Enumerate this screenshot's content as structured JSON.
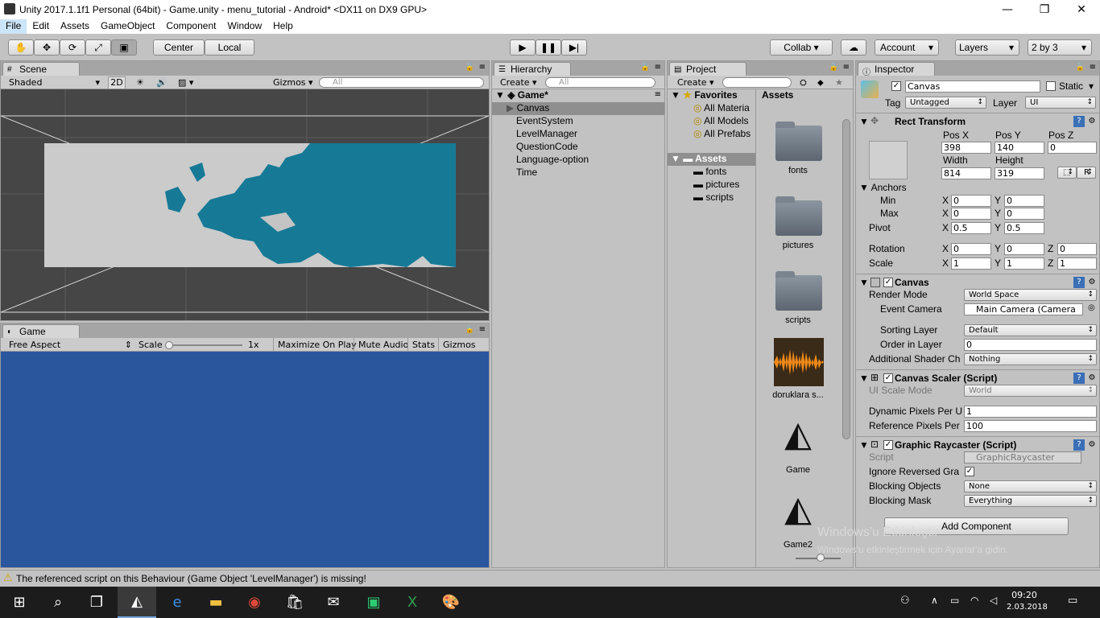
{
  "window": {
    "title": "Unity 2017.1.1f1 Personal (64bit) - Game.unity - menu_tutorial - Android* <DX11 on DX9 GPU>",
    "minimize": "—",
    "maximize": "❐",
    "close": "✕"
  },
  "menu": [
    "File",
    "Edit",
    "Assets",
    "GameObject",
    "Component",
    "Window",
    "Help"
  ],
  "toolbar": {
    "center": "Center",
    "local": "Local",
    "collab": "Collab ▾",
    "account": "Account",
    "layers": "Layers",
    "layout": "2 by 3"
  },
  "scene": {
    "tab": "Scene",
    "shading": "Shaded",
    "mode2d": "2D",
    "gizmos": "Gizmos ▾",
    "search": "All"
  },
  "game": {
    "tab": "Game",
    "aspect": "Free Aspect",
    "scale_label": "Scale",
    "scale_value": "1x",
    "maximize": "Maximize On Play",
    "mute": "Mute Audio",
    "stats": "Stats",
    "gizmos": "Gizmos"
  },
  "hierarchy": {
    "tab": "Hierarchy",
    "create": "Create ▾",
    "search": "All",
    "scene": "Game*",
    "items": [
      "Canvas",
      "EventSystem",
      "LevelManager",
      "QuestionCode",
      "Language-option",
      "Time"
    ]
  },
  "project": {
    "tab": "Project",
    "create": "Create ▾",
    "favorites": "Favorites",
    "fav_items": [
      "All Materia",
      "All Models",
      "All Prefabs"
    ],
    "assets": "Assets",
    "folders": [
      "fonts",
      "pictures",
      "scripts"
    ],
    "assets_header": "Assets",
    "grid": [
      "fonts",
      "pictures",
      "scripts",
      "doruklara s...",
      "Game",
      "Game2"
    ]
  },
  "inspector": {
    "tab": "Inspector",
    "name": "Canvas",
    "static": "Static",
    "tag_label": "Tag",
    "tag": "Untagged",
    "layer_label": "Layer",
    "layer": "UI",
    "rect": {
      "title": "Rect Transform",
      "posx_l": "Pos X",
      "posy_l": "Pos Y",
      "posz_l": "Pos Z",
      "posx": "398",
      "posy": "140",
      "posz": "0",
      "width_l": "Width",
      "height_l": "Height",
      "width": "814",
      "height": "319",
      "anchors": "Anchors",
      "min": "Min",
      "max": "Max",
      "minx": "0",
      "miny": "0",
      "maxx": "0",
      "maxy": "0",
      "pivot": "Pivot",
      "pivx": "0.5",
      "pivy": "0.5",
      "rotation": "Rotation",
      "rotx": "0",
      "roty": "0",
      "rotz": "0",
      "scale": "Scale",
      "sx": "1",
      "sy": "1",
      "sz": "1",
      "x": "X",
      "y": "Y",
      "z": "Z",
      "r": "R"
    },
    "canvas": {
      "title": "Canvas",
      "render_mode_l": "Render Mode",
      "render_mode": "World Space",
      "event_cam_l": "Event Camera",
      "event_cam": "Main Camera (Camera",
      "sorting_l": "Sorting Layer",
      "sorting": "Default",
      "order_l": "Order in Layer",
      "order": "0",
      "shader_l": "Additional Shader Ch",
      "shader": "Nothing"
    },
    "scaler": {
      "title": "Canvas Scaler (Script)",
      "ui_scale_l": "UI Scale Mode",
      "ui_scale": "World",
      "dpp_l": "Dynamic Pixels Per U",
      "dpp": "1",
      "rpp_l": "Reference Pixels Per",
      "rpp": "100"
    },
    "raycaster": {
      "title": "Graphic Raycaster (Script)",
      "script_l": "Script",
      "script": "GraphicRaycaster",
      "ignore_l": "Ignore Reversed Gra",
      "blocking_l": "Blocking Objects",
      "blocking": "None",
      "mask_l": "Blocking Mask",
      "mask": "Everything"
    },
    "add_component": "Add Component"
  },
  "watermark": {
    "line1": "Windows'u Etkinleştir",
    "line2": "Windows'u etkinleştirmek için Ayarlar'a gidin."
  },
  "status": "The referenced script on this Behaviour (Game Object 'LevelManager') is missing!",
  "taskbar": {
    "time": "09:20",
    "date": "2.03.2018"
  },
  "colors": {
    "game_bg": "#2a569e",
    "map_sea": "#cbcbcb",
    "map_land": "#167a96",
    "scene_bg": "#464646"
  }
}
